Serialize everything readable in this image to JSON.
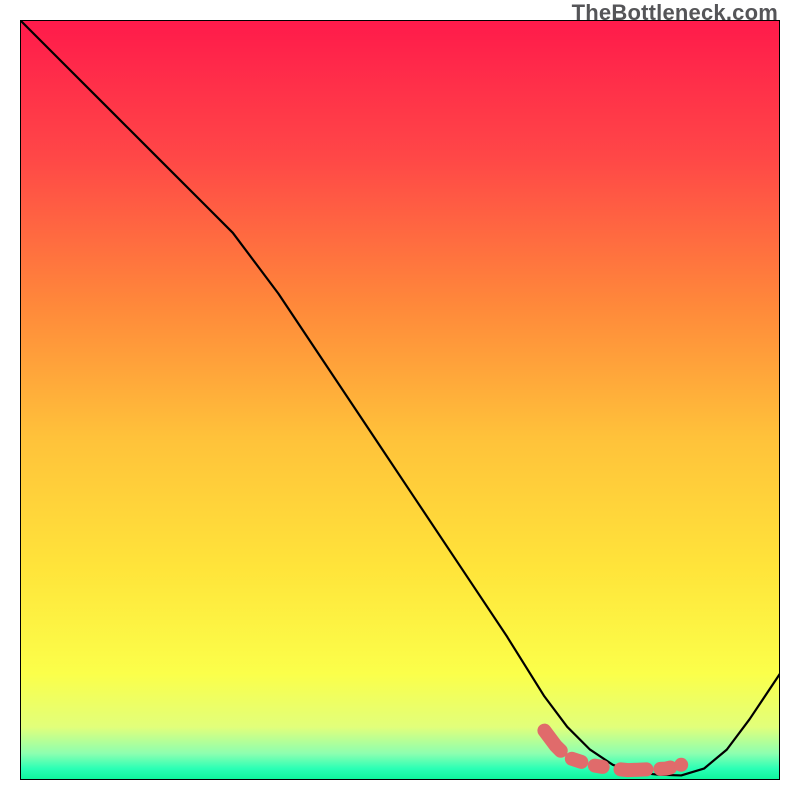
{
  "watermark": "TheBottleneck.com",
  "chart_data": {
    "type": "line",
    "title": "",
    "xlabel": "",
    "ylabel": "",
    "xlim": [
      0,
      100
    ],
    "ylim": [
      0,
      100
    ],
    "grid": false,
    "legend": false,
    "background_gradient": {
      "stops": [
        {
          "offset": 0.0,
          "color": "#ff1a4b"
        },
        {
          "offset": 0.18,
          "color": "#ff4747"
        },
        {
          "offset": 0.38,
          "color": "#ff8a3a"
        },
        {
          "offset": 0.55,
          "color": "#ffc23a"
        },
        {
          "offset": 0.72,
          "color": "#ffe43a"
        },
        {
          "offset": 0.86,
          "color": "#fbff4a"
        },
        {
          "offset": 0.93,
          "color": "#e2ff7a"
        },
        {
          "offset": 0.965,
          "color": "#8dffb0"
        },
        {
          "offset": 0.985,
          "color": "#2bffb5"
        },
        {
          "offset": 1.0,
          "color": "#0cf59a"
        }
      ]
    },
    "series": [
      {
        "name": "bottleneck-curve",
        "style": "solid-black",
        "x": [
          0,
          6,
          12,
          18,
          24,
          28,
          34,
          40,
          46,
          52,
          58,
          64,
          69,
          72,
          75,
          78,
          81,
          84,
          87,
          90,
          93,
          96,
          100
        ],
        "y": [
          100,
          94,
          88,
          82,
          76,
          72,
          64,
          55,
          46,
          37,
          28,
          19,
          11,
          7,
          4,
          2,
          1,
          0.7,
          0.6,
          1.5,
          4,
          8,
          14
        ]
      },
      {
        "name": "highlight-sweet-spot",
        "style": "coral-dash",
        "x": [
          69,
          70.5,
          72,
          75,
          78,
          80,
          82.5,
          85,
          87
        ],
        "y": [
          6.5,
          4.5,
          3,
          2,
          1.5,
          1.3,
          1.4,
          1.5,
          2
        ]
      }
    ],
    "annotations": []
  }
}
